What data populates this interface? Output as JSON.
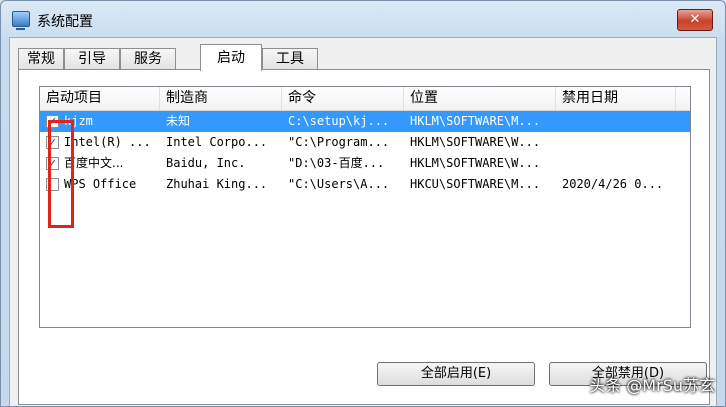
{
  "window": {
    "title": "系统配置",
    "close_label": "✕"
  },
  "tabs": [
    {
      "label": "常规"
    },
    {
      "label": "引导"
    },
    {
      "label": "服务"
    },
    {
      "label": "启动",
      "active": true
    },
    {
      "label": "工具"
    }
  ],
  "list": {
    "columns": [
      "启动项目",
      "制造商",
      "命令",
      "位置",
      "禁用日期"
    ],
    "rows": [
      {
        "checked": true,
        "name": "kjzm",
        "vendor": "未知",
        "command": "C:\\setup\\kj...",
        "location": "HKLM\\SOFTWARE\\M...",
        "date": ""
      },
      {
        "checked": true,
        "name": "Intel(R) ...",
        "vendor": "Intel Corpo...",
        "command": "\"C:\\Program...",
        "location": "HKLM\\SOFTWARE\\W...",
        "date": ""
      },
      {
        "checked": true,
        "name": "百度中文...",
        "vendor": "Baidu, Inc.",
        "command": "\"D:\\03-百度...",
        "location": "HKLM\\SOFTWARE\\W...",
        "date": ""
      },
      {
        "checked": false,
        "name": "WPS Office",
        "vendor": "Zhuhai King...",
        "command": "\"C:\\Users\\A...",
        "location": "HKCU\\SOFTWARE\\M...",
        "date": "2020/4/26 0..."
      }
    ],
    "selected_index": 0
  },
  "buttons": {
    "enable_all": "全部启用(E)",
    "disable_all": "全部禁用(D)"
  },
  "watermark": "头条 @MrSu苏玄",
  "colors": {
    "selection": "#3399ff",
    "highlight_box": "#e2231a"
  }
}
